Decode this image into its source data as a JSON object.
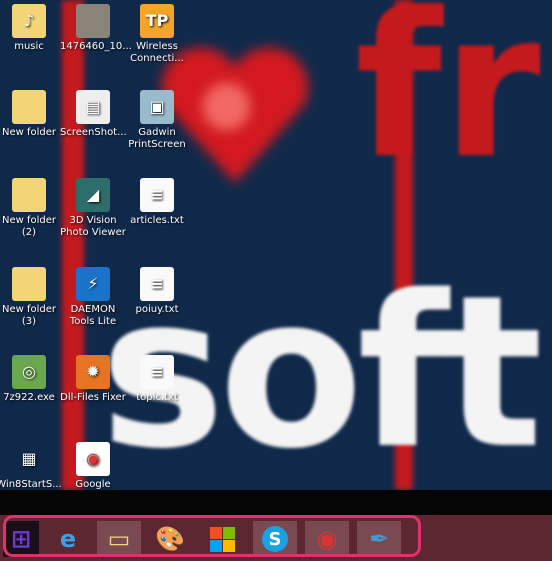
{
  "wallpaper": {
    "text_top": "fr",
    "text_bottom": "soft",
    "accent": "#c41a1e",
    "background": "#10294a"
  },
  "desktop": {
    "icons": [
      {
        "label": "music",
        "icon": "music-folder-icon"
      },
      {
        "label": "New folder",
        "icon": "folder-icon"
      },
      {
        "label": "New folder (2)",
        "icon": "folder-icon"
      },
      {
        "label": "New folder (3)",
        "icon": "folder-icon"
      },
      {
        "label": "7z922.exe",
        "icon": "installer-icon"
      },
      {
        "label": "Win8StartS...",
        "icon": "grid-app-icon"
      },
      {
        "label": "1476460_10...",
        "icon": "photo-icon"
      },
      {
        "label": "ScreenShot...",
        "icon": "screenshot-icon"
      },
      {
        "label": "3D Vision Photo Viewer",
        "icon": "3d-vision-icon"
      },
      {
        "label": "DAEMON Tools Lite",
        "icon": "daemon-tools-icon"
      },
      {
        "label": "Dll-Files Fixer",
        "icon": "gear-icon"
      },
      {
        "label": "Google Chrome",
        "icon": "chrome-icon"
      },
      {
        "label": "Wireless Connecti...",
        "icon": "tplink-icon"
      },
      {
        "label": "Gadwin PrintScreen",
        "icon": "camera-icon"
      },
      {
        "label": "articles.txt",
        "icon": "text-file-icon"
      },
      {
        "label": "poiuy.txt",
        "icon": "text-file-icon"
      },
      {
        "label": "topic.txt",
        "icon": "text-file-icon"
      }
    ]
  },
  "taskbar": {
    "items": [
      {
        "name": "start",
        "icon": "windows-logo-icon"
      },
      {
        "name": "internet-explorer",
        "icon": "ie-icon"
      },
      {
        "name": "file-explorer",
        "icon": "folder-icon"
      },
      {
        "name": "paint",
        "icon": "palette-icon"
      },
      {
        "name": "store",
        "icon": "store-icon"
      },
      {
        "name": "skype",
        "icon": "skype-icon"
      },
      {
        "name": "chrome",
        "icon": "chrome-icon"
      },
      {
        "name": "pen-app",
        "icon": "pen-icon"
      }
    ],
    "highlight_color": "#e2306e"
  }
}
